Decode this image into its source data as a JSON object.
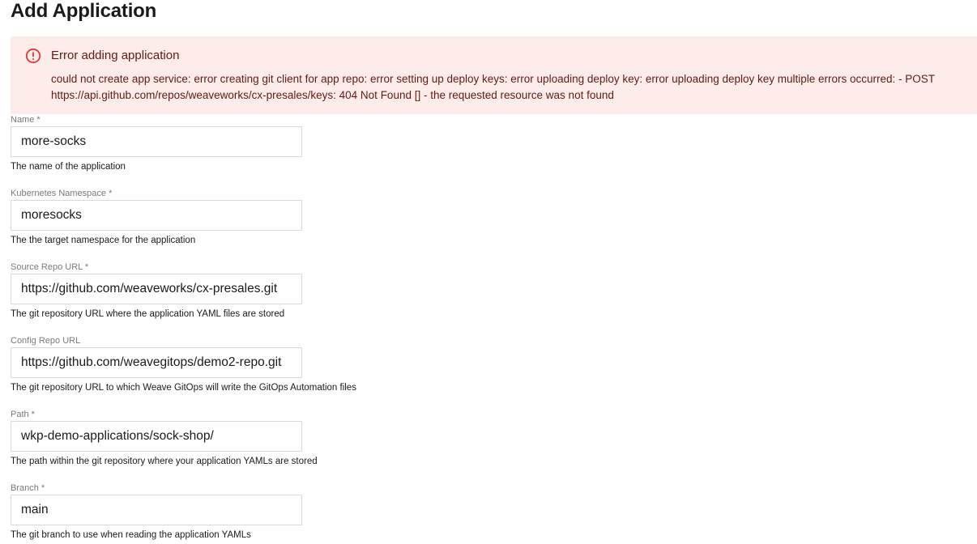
{
  "page": {
    "title": "Add Application"
  },
  "alert": {
    "icon": "error-outline-icon",
    "title": "Error adding application",
    "message": "could not create app service: error creating git client for app repo: error setting up deploy keys: error uploading deploy key: error uploading deploy key multiple errors occurred: - POST https://api.github.com/repos/weaveworks/cx-presales/keys: 404 Not Found [] - the requested resource was not found",
    "color": "#e53935",
    "background": "#fdecea"
  },
  "fields": [
    {
      "label": "Name *",
      "value": "more-socks",
      "help": "The name of the application"
    },
    {
      "label": "Kubernetes Namespace *",
      "value": "moresocks",
      "help": "The the target namespace for the application"
    },
    {
      "label": "Source Repo URL *",
      "value": "https://github.com/weaveworks/cx-presales.git",
      "help": "The git repository URL where the application YAML files are stored"
    },
    {
      "label": "Config Repo URL",
      "value": "https://github.com/weavegitops/demo2-repo.git",
      "help": "The git repository URL to which Weave GitOps will write the GitOps Automation files"
    },
    {
      "label": "Path *",
      "value": "wkp-demo-applications/sock-shop/",
      "help": "The path within the git repository where your application YAMLs are stored"
    },
    {
      "label": "Branch *",
      "value": "main",
      "help": "The git branch to use when reading the application YAMLs"
    }
  ]
}
